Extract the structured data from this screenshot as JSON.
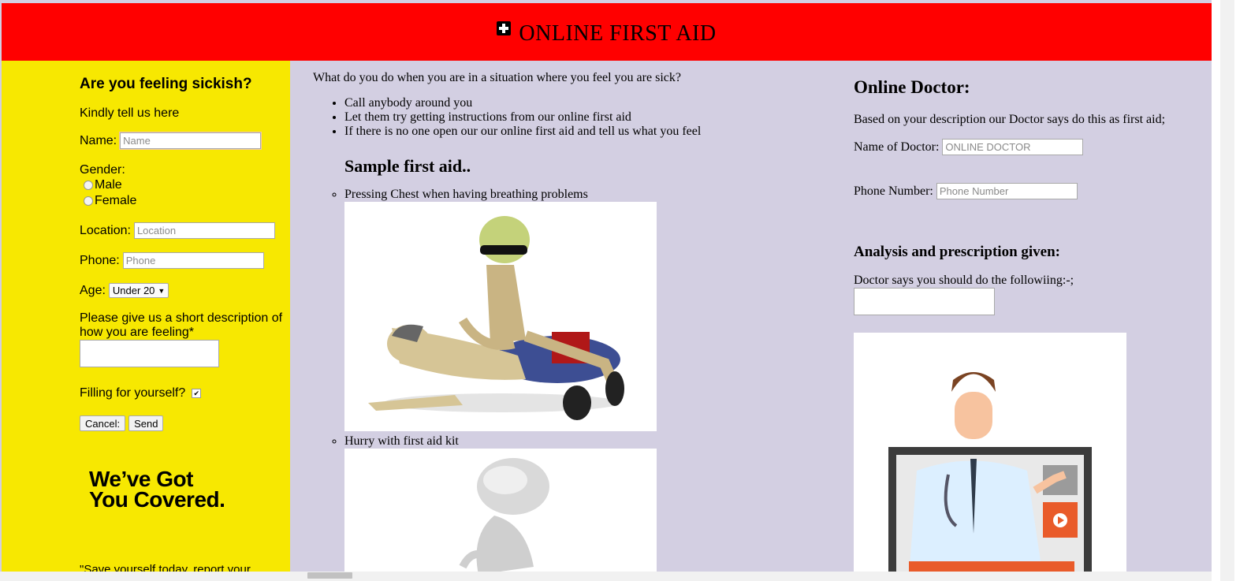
{
  "header": {
    "title": "ONLINE FIRST AID",
    "icon": "first-aid-plus-icon"
  },
  "form": {
    "heading": "Are you feeling sickish?",
    "intro": "Kindly tell us here",
    "name_label": "Name:",
    "name_placeholder": "Name",
    "gender_label": "Gender:",
    "gender_male": "Male",
    "gender_female": "Female",
    "location_label": "Location:",
    "location_placeholder": "Location",
    "phone_label": "Phone:",
    "phone_placeholder": "Phone",
    "age_label": "Age:",
    "age_value": "Under 20",
    "description_label": "Please give us a short description of how you are feeling*",
    "self_label": "Filling for yourself?",
    "self_checked": true,
    "cancel_label": "Cancel:",
    "send_label": "Send",
    "slogan_line1": "We’ve Got",
    "slogan_line2": "You Covered.",
    "quote": "\"Save yourself today, report your"
  },
  "middle": {
    "question": "What do you do when you are in a situation where you feel you are sick?",
    "steps": [
      "Call anybody around you",
      "Let them try getting instructions from our online first aid",
      "If there is no one open our our online first aid and tell us what you feel"
    ],
    "sample_heading": "Sample first aid..",
    "samples": [
      "Pressing Chest when having breathing problems",
      "Hurry with first aid kit"
    ]
  },
  "doctor": {
    "heading": "Online Doctor:",
    "intro": "Based on your description our Doctor says do this as first aid;",
    "name_label": "Name of Doctor:",
    "name_placeholder": "ONLINE DOCTOR",
    "phone_label": "Phone Number:",
    "phone_placeholder": "Phone Number",
    "analysis_heading": "Analysis and prescription given:",
    "analysis_intro": "Doctor says you should do the followiing:-;"
  },
  "colors": {
    "header": "#ff0000",
    "sidebar": "#f7e801",
    "page": "#d3cfe2"
  }
}
